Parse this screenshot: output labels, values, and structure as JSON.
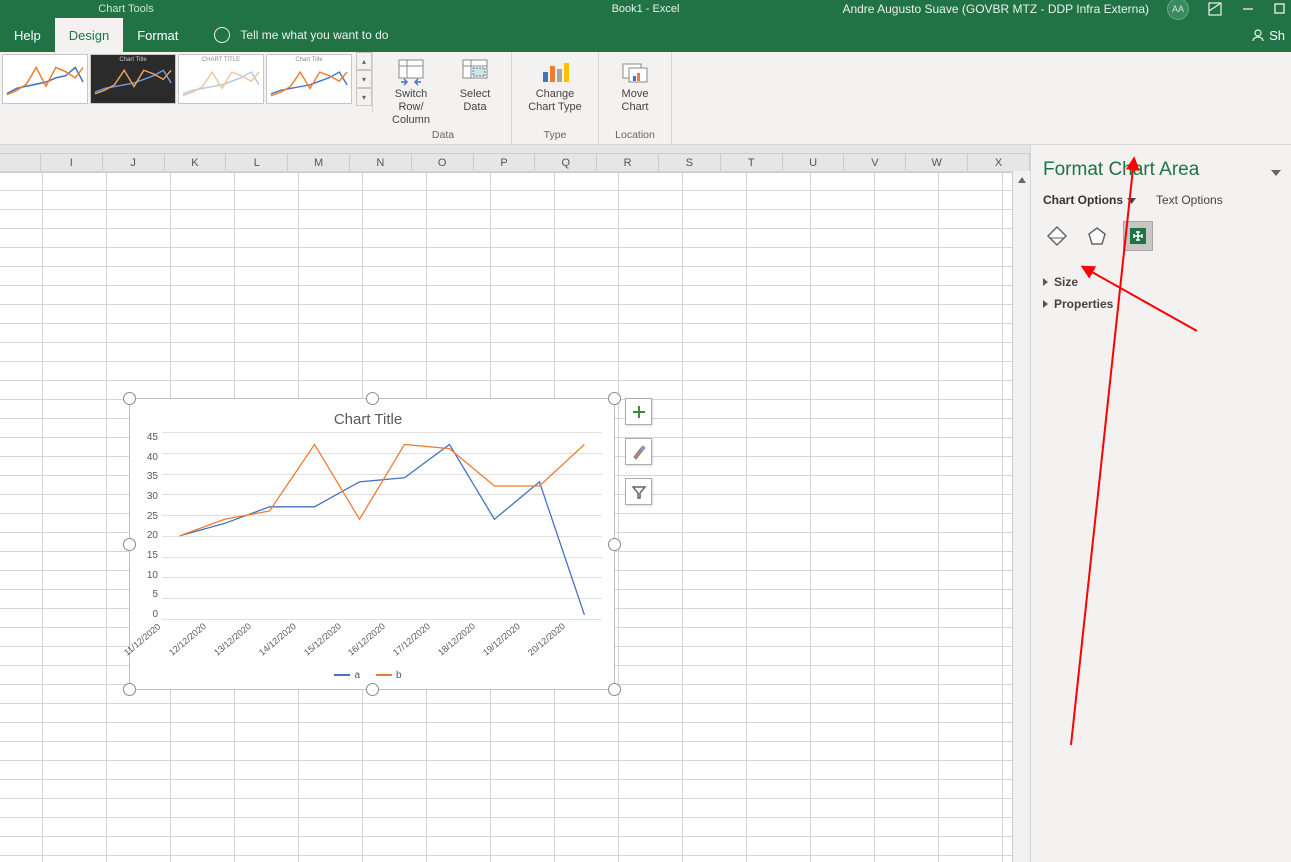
{
  "titlebar": {
    "contextual": "Chart Tools",
    "document": "Book1  -  Excel",
    "user": "Andre Augusto Suave (GOVBR MTZ - DDP Infra Externa)",
    "initials": "AA",
    "share_label": "Sh"
  },
  "tabs": {
    "help": "Help",
    "design": "Design",
    "format": "Format",
    "tellme": "Tell me what you want to do"
  },
  "ribbon": {
    "style1_title": "Chart Title",
    "style2_title": "Chart Title",
    "style3_title": "CHART TITLE",
    "style4_title": "Chart Title",
    "switch_row_col": "Switch Row/\nColumn",
    "select_data": "Select\nData",
    "change_chart_type": "Change\nChart Type",
    "move_chart": "Move\nChart",
    "group_data": "Data",
    "group_type": "Type",
    "group_location": "Location"
  },
  "columns": [
    "I",
    "J",
    "K",
    "L",
    "M",
    "N",
    "O",
    "P",
    "Q",
    "R",
    "S",
    "T",
    "U",
    "V",
    "W",
    "X"
  ],
  "chart_data": {
    "type": "line",
    "title": "Chart Title",
    "categories": [
      "11/12/2020",
      "12/12/2020",
      "13/12/2020",
      "14/12/2020",
      "15/12/2020",
      "16/12/2020",
      "17/12/2020",
      "18/12/2020",
      "19/12/2020",
      "20/12/2020"
    ],
    "series": [
      {
        "name": "a",
        "color": "#4472c4",
        "values": [
          20,
          23,
          27,
          27,
          33,
          34,
          42,
          24,
          33,
          1
        ]
      },
      {
        "name": "b",
        "color": "#ed7d31",
        "values": [
          20,
          24,
          26,
          42,
          24,
          42,
          41,
          32,
          32,
          42
        ]
      }
    ],
    "ylabel": "",
    "xlabel": "",
    "ylim": [
      0,
      45
    ],
    "ystep": 5
  },
  "side_pane": {
    "title": "Format Chart Area",
    "tab_chart_options": "Chart Options",
    "tab_text_options": "Text Options",
    "section_size": "Size",
    "section_properties": "Properties"
  }
}
